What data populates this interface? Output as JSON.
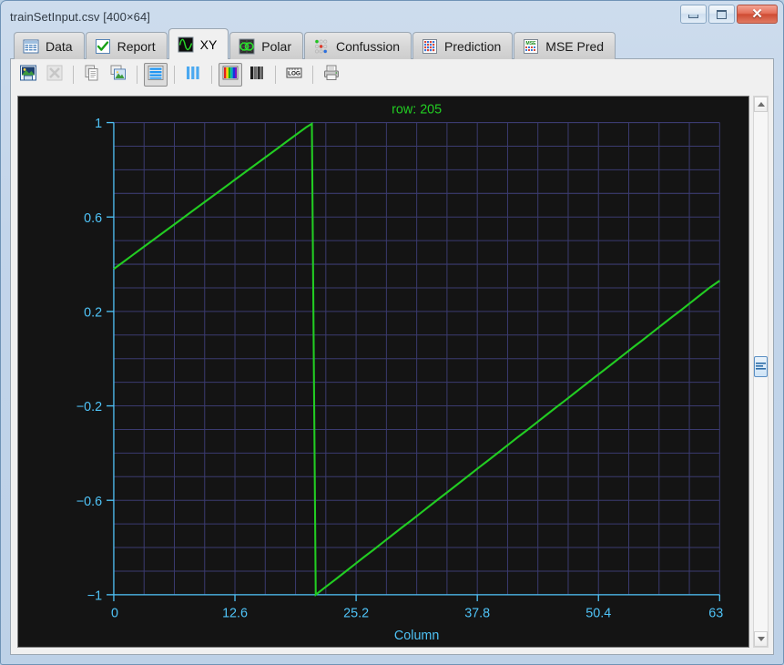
{
  "window": {
    "title": "trainSetInput.csv [400×64]",
    "minimize_label": "Minimize",
    "maximize_label": "Maximize",
    "close_label": "Close"
  },
  "tabs": [
    {
      "id": "data",
      "label": "Data",
      "icon": "table-icon",
      "active": false
    },
    {
      "id": "report",
      "label": "Report",
      "icon": "check-icon",
      "active": false
    },
    {
      "id": "xy",
      "label": "XY",
      "icon": "waveform-icon",
      "active": true
    },
    {
      "id": "polar",
      "label": "Polar",
      "icon": "polar-icon",
      "active": false
    },
    {
      "id": "confussion",
      "label": "Confussion",
      "icon": "confusion-icon",
      "active": false
    },
    {
      "id": "prediction",
      "label": "Prediction",
      "icon": "prediction-icon",
      "active": false
    },
    {
      "id": "msepred",
      "label": "MSE Pred",
      "icon": "mse-icon",
      "active": false
    }
  ],
  "toolbar": [
    {
      "id": "save-image",
      "icon": "save-image-icon",
      "label": "Save image",
      "enabled": true,
      "pressed": false
    },
    {
      "id": "export-excel",
      "icon": "excel-icon",
      "label": "Export to Excel",
      "enabled": false,
      "pressed": false
    },
    {
      "id": "copy",
      "icon": "copy-icon",
      "label": "Copy",
      "enabled": true,
      "pressed": false
    },
    {
      "id": "copy-image",
      "icon": "copy-image-icon",
      "label": "Copy image",
      "enabled": true,
      "pressed": false
    },
    {
      "id": "rows-view",
      "icon": "horizontal-bars-icon",
      "label": "Rows view",
      "enabled": true,
      "pressed": true
    },
    {
      "id": "columns-view",
      "icon": "vertical-bars-icon",
      "label": "Columns view",
      "enabled": true,
      "pressed": false
    },
    {
      "id": "color-mode",
      "icon": "color-bars-icon",
      "label": "Color mode",
      "enabled": true,
      "pressed": true
    },
    {
      "id": "gray-mode",
      "icon": "gray-bars-icon",
      "label": "Grayscale mode",
      "enabled": true,
      "pressed": false
    },
    {
      "id": "log-scale",
      "icon": "log-icon",
      "label": "LOG",
      "enabled": true,
      "pressed": false
    },
    {
      "id": "print",
      "icon": "printer-icon",
      "label": "Print",
      "enabled": true,
      "pressed": false
    }
  ],
  "scrollbar": {
    "up_label": "Scroll up",
    "down_label": "Scroll down",
    "thumb_label": "Scroll thumb"
  },
  "chart_data": {
    "type": "line",
    "title": "row: 205",
    "xlabel": "Column",
    "ylabel": "",
    "xlim": [
      0,
      63
    ],
    "ylim": [
      -1,
      1
    ],
    "xticks": [
      0,
      12.6,
      25.2,
      37.8,
      50.4,
      63
    ],
    "xticklabels": [
      "0",
      "12.6",
      "25.2",
      "37.8",
      "50.4",
      "63"
    ],
    "yticks": [
      1,
      0.6,
      0.2,
      -0.2,
      -0.6,
      -1
    ],
    "yticklabels": [
      "1",
      "0.6",
      "0.2",
      "−0.2",
      "−0.6",
      "−1"
    ],
    "grid": true,
    "grid_color": "#3b3b70",
    "background": "#141414",
    "axis_color": "#4fc3f7",
    "title_color": "#22cc22",
    "legend": null,
    "series": [
      {
        "name": "row 205",
        "color": "#22cc22",
        "x": [
          0,
          1,
          2,
          3,
          4,
          5,
          6,
          7,
          8,
          9,
          10,
          11,
          12,
          13,
          14,
          15,
          16,
          17,
          18,
          19,
          20,
          20.6,
          21,
          22,
          23,
          24,
          25,
          26,
          27,
          28,
          29,
          30,
          31,
          32,
          33,
          34,
          35,
          36,
          37,
          38,
          39,
          40,
          41,
          42,
          43,
          44,
          45,
          46,
          47,
          48,
          49,
          50,
          51,
          52,
          53,
          54,
          55,
          56,
          57,
          58,
          59,
          60,
          61,
          62,
          63
        ],
        "y": [
          0.38,
          0.41,
          0.44,
          0.47,
          0.5,
          0.53,
          0.56,
          0.59,
          0.62,
          0.65,
          0.68,
          0.71,
          0.74,
          0.77,
          0.8,
          0.83,
          0.86,
          0.89,
          0.92,
          0.95,
          0.98,
          0.995,
          -1.0,
          -0.968,
          -0.937,
          -0.905,
          -0.873,
          -0.841,
          -0.81,
          -0.778,
          -0.746,
          -0.714,
          -0.683,
          -0.651,
          -0.619,
          -0.587,
          -0.556,
          -0.524,
          -0.492,
          -0.46,
          -0.429,
          -0.397,
          -0.365,
          -0.333,
          -0.302,
          -0.27,
          -0.238,
          -0.206,
          -0.175,
          -0.143,
          -0.111,
          -0.079,
          -0.048,
          -0.016,
          0.016,
          0.048,
          0.079,
          0.111,
          0.143,
          0.175,
          0.206,
          0.238,
          0.27,
          0.302,
          0.33
        ]
      }
    ]
  }
}
